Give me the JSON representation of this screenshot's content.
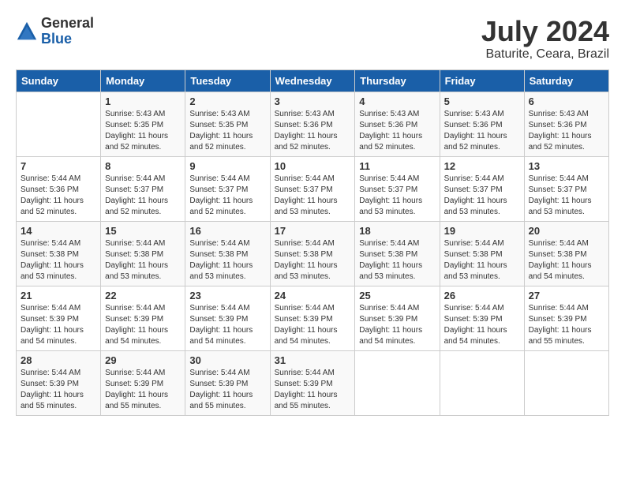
{
  "logo": {
    "general": "General",
    "blue": "Blue"
  },
  "title": "July 2024",
  "subtitle": "Baturite, Ceara, Brazil",
  "days_of_week": [
    "Sunday",
    "Monday",
    "Tuesday",
    "Wednesday",
    "Thursday",
    "Friday",
    "Saturday"
  ],
  "weeks": [
    [
      {
        "day": "",
        "info": ""
      },
      {
        "day": "1",
        "info": "Sunrise: 5:43 AM\nSunset: 5:35 PM\nDaylight: 11 hours\nand 52 minutes."
      },
      {
        "day": "2",
        "info": "Sunrise: 5:43 AM\nSunset: 5:35 PM\nDaylight: 11 hours\nand 52 minutes."
      },
      {
        "day": "3",
        "info": "Sunrise: 5:43 AM\nSunset: 5:36 PM\nDaylight: 11 hours\nand 52 minutes."
      },
      {
        "day": "4",
        "info": "Sunrise: 5:43 AM\nSunset: 5:36 PM\nDaylight: 11 hours\nand 52 minutes."
      },
      {
        "day": "5",
        "info": "Sunrise: 5:43 AM\nSunset: 5:36 PM\nDaylight: 11 hours\nand 52 minutes."
      },
      {
        "day": "6",
        "info": "Sunrise: 5:43 AM\nSunset: 5:36 PM\nDaylight: 11 hours\nand 52 minutes."
      }
    ],
    [
      {
        "day": "7",
        "info": "Sunrise: 5:44 AM\nSunset: 5:36 PM\nDaylight: 11 hours\nand 52 minutes."
      },
      {
        "day": "8",
        "info": "Sunrise: 5:44 AM\nSunset: 5:37 PM\nDaylight: 11 hours\nand 52 minutes."
      },
      {
        "day": "9",
        "info": "Sunrise: 5:44 AM\nSunset: 5:37 PM\nDaylight: 11 hours\nand 52 minutes."
      },
      {
        "day": "10",
        "info": "Sunrise: 5:44 AM\nSunset: 5:37 PM\nDaylight: 11 hours\nand 53 minutes."
      },
      {
        "day": "11",
        "info": "Sunrise: 5:44 AM\nSunset: 5:37 PM\nDaylight: 11 hours\nand 53 minutes."
      },
      {
        "day": "12",
        "info": "Sunrise: 5:44 AM\nSunset: 5:37 PM\nDaylight: 11 hours\nand 53 minutes."
      },
      {
        "day": "13",
        "info": "Sunrise: 5:44 AM\nSunset: 5:37 PM\nDaylight: 11 hours\nand 53 minutes."
      }
    ],
    [
      {
        "day": "14",
        "info": "Sunrise: 5:44 AM\nSunset: 5:38 PM\nDaylight: 11 hours\nand 53 minutes."
      },
      {
        "day": "15",
        "info": "Sunrise: 5:44 AM\nSunset: 5:38 PM\nDaylight: 11 hours\nand 53 minutes."
      },
      {
        "day": "16",
        "info": "Sunrise: 5:44 AM\nSunset: 5:38 PM\nDaylight: 11 hours\nand 53 minutes."
      },
      {
        "day": "17",
        "info": "Sunrise: 5:44 AM\nSunset: 5:38 PM\nDaylight: 11 hours\nand 53 minutes."
      },
      {
        "day": "18",
        "info": "Sunrise: 5:44 AM\nSunset: 5:38 PM\nDaylight: 11 hours\nand 53 minutes."
      },
      {
        "day": "19",
        "info": "Sunrise: 5:44 AM\nSunset: 5:38 PM\nDaylight: 11 hours\nand 53 minutes."
      },
      {
        "day": "20",
        "info": "Sunrise: 5:44 AM\nSunset: 5:38 PM\nDaylight: 11 hours\nand 54 minutes."
      }
    ],
    [
      {
        "day": "21",
        "info": "Sunrise: 5:44 AM\nSunset: 5:39 PM\nDaylight: 11 hours\nand 54 minutes."
      },
      {
        "day": "22",
        "info": "Sunrise: 5:44 AM\nSunset: 5:39 PM\nDaylight: 11 hours\nand 54 minutes."
      },
      {
        "day": "23",
        "info": "Sunrise: 5:44 AM\nSunset: 5:39 PM\nDaylight: 11 hours\nand 54 minutes."
      },
      {
        "day": "24",
        "info": "Sunrise: 5:44 AM\nSunset: 5:39 PM\nDaylight: 11 hours\nand 54 minutes."
      },
      {
        "day": "25",
        "info": "Sunrise: 5:44 AM\nSunset: 5:39 PM\nDaylight: 11 hours\nand 54 minutes."
      },
      {
        "day": "26",
        "info": "Sunrise: 5:44 AM\nSunset: 5:39 PM\nDaylight: 11 hours\nand 54 minutes."
      },
      {
        "day": "27",
        "info": "Sunrise: 5:44 AM\nSunset: 5:39 PM\nDaylight: 11 hours\nand 55 minutes."
      }
    ],
    [
      {
        "day": "28",
        "info": "Sunrise: 5:44 AM\nSunset: 5:39 PM\nDaylight: 11 hours\nand 55 minutes."
      },
      {
        "day": "29",
        "info": "Sunrise: 5:44 AM\nSunset: 5:39 PM\nDaylight: 11 hours\nand 55 minutes."
      },
      {
        "day": "30",
        "info": "Sunrise: 5:44 AM\nSunset: 5:39 PM\nDaylight: 11 hours\nand 55 minutes."
      },
      {
        "day": "31",
        "info": "Sunrise: 5:44 AM\nSunset: 5:39 PM\nDaylight: 11 hours\nand 55 minutes."
      },
      {
        "day": "",
        "info": ""
      },
      {
        "day": "",
        "info": ""
      },
      {
        "day": "",
        "info": ""
      }
    ]
  ]
}
